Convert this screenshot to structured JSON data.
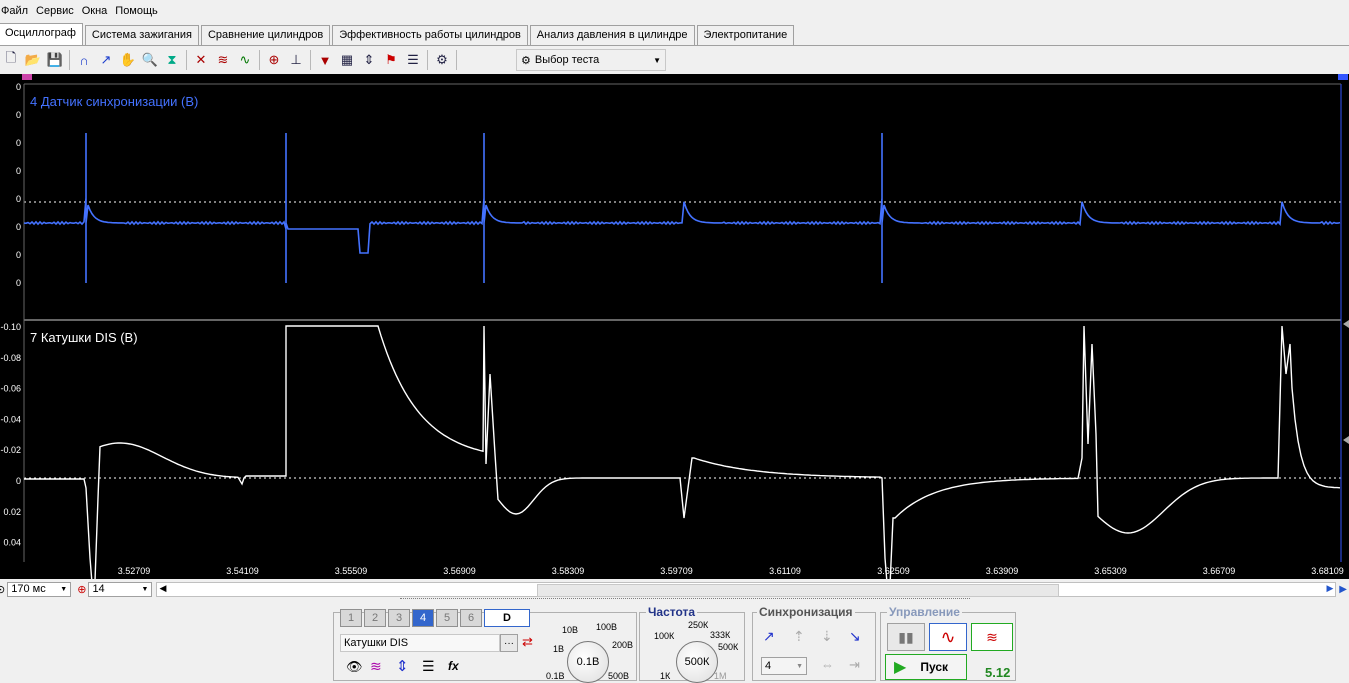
{
  "menu": [
    "Файл",
    "Сервис",
    "Окна",
    "Помощь"
  ],
  "tabs": [
    {
      "label": "Осциллограф",
      "active": true
    },
    {
      "label": "Система зажигания"
    },
    {
      "label": "Сравнение цилиндров"
    },
    {
      "label": "Эффективность работы цилиндров"
    },
    {
      "label": "Анализ давления в цилиндре"
    },
    {
      "label": "Электропитание"
    }
  ],
  "toolbar": {
    "test_select": "Выбор теста"
  },
  "channels": {
    "top": {
      "title": "4 Датчик синхронизации (В)",
      "color": "#4472ff",
      "y_labels": [
        "0",
        "0",
        "0",
        "0",
        "0",
        "0",
        "0",
        "0"
      ]
    },
    "bottom": {
      "title": "7 Катушки DIS (В)",
      "color": "#ffffff",
      "y_labels": [
        "-0.10",
        "-0.08",
        "-0.06",
        "-0.04",
        "-0.02",
        "0",
        "0.02",
        "0.04"
      ]
    }
  },
  "x_ticks": [
    "3.52709",
    "3.54109",
    "3.55509",
    "3.56909",
    "3.58309",
    "3.59709",
    "3.61109",
    "3.62509",
    "3.63909",
    "3.65309",
    "3.66709",
    "3.68109"
  ],
  "sweep": {
    "value": "170 мс"
  },
  "channel_select": {
    "value": "14"
  },
  "channel_buttons": [
    "1",
    "2",
    "3",
    "4",
    "5",
    "6",
    "D"
  ],
  "active_channel": "4",
  "sensor_name": "Катушки DIS",
  "voltage": {
    "value": "0.1В",
    "marks": [
      "10В",
      "100В",
      "1В",
      "200В",
      "0.1В",
      "500В"
    ]
  },
  "frequency": {
    "title": "Частота",
    "value": "500К",
    "marks": [
      "250К",
      "100К",
      "333К",
      "500К",
      "1К",
      "1М"
    ]
  },
  "sync": {
    "title": "Синхронизация",
    "channel": "4"
  },
  "control": {
    "title": "Управление",
    "start": "Пуск",
    "version": "5.12"
  }
}
